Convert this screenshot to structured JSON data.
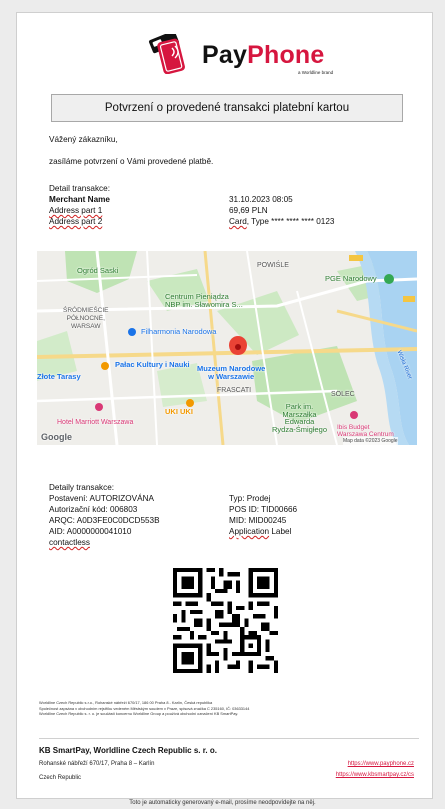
{
  "logo": {
    "brand_pay": "Pay",
    "brand_phone": "Phone",
    "sub": "a Worldline brand"
  },
  "title": "Potvrzení o provedené transakci platební kartou",
  "greeting": "Vážený zákazníku,",
  "intro": "zasíláme potvrzení o Vámi provedené platbě.",
  "detail_header": "Detail transakce:",
  "merchant": {
    "name": "Merchant Name",
    "address1": "Address part 1",
    "address2": "Address part 2",
    "datetime": "31.10.2023 08:05",
    "amount": "69,69 PLN",
    "card_prefix": "Card",
    "card_rest": ", Type **** **** **** 0123"
  },
  "map": {
    "labels": {
      "ogrod": "Ogród Saski",
      "powisle": "POWIŚLE",
      "srodmiescie": "ŚRÓDMIEŚCIE\nPÓŁNOCNE,\nWARSAW",
      "centrum": "Centrum Pieniądza\nNBP im. Sławomira S...",
      "pge": "PGE Narodowy",
      "filharmonia": "Filharmonia Narodowa",
      "zlote": "Złote Tarasy",
      "palac": "Pałac Kultury i Nauki",
      "muzeum": "Muzeum Narodowe\nw Warszawie",
      "frascati": "FRASCATI",
      "solec": "SOLEC",
      "park": "Park im.\nMarszałka\nEdwarda\nRydza-Śmigłego",
      "uki": "UKI UKI",
      "marriott": "Hotel Marriott Warszawa",
      "ibis": "Ibis Budget\nWarszawa Centrum",
      "wisla": "Wisła River",
      "google": "Google",
      "mapdata": "Map data ©2023 Google"
    }
  },
  "details": {
    "header": "Detaily transakce:",
    "status": "Postavení: AUTORIZOVÁNA",
    "auth_code": "Autorizační kód: 006803",
    "arqc": "ARQC: A0D3FE0C0DCD553B",
    "aid": "AID: A0000000041010",
    "contactless": "contactless",
    "type": "Typ: Prodej",
    "pos_id": "POS ID: TID00666",
    "mid": "MID: MID00245",
    "app_label_prefix": "Application",
    "app_label_rest": " Label"
  },
  "footer": {
    "legal1": "Worldline Czech Republic s.r.o., Rohanské nábřeží 670/17, 186 00 Praha 8 - Karlín, Česká republika",
    "legal2": "Společnost zapsána v obchodním rejstříku vedeném Městským soudem v Praze, spisová značka C 235160, IČ: 03633144",
    "legal3": "Worldline Czech Republic s. r. o. je součástí koncernu Worldline Group a používá obchodní označení KB SmartPay.",
    "company": "KB SmartPay, Worldline Czech Republic s. r. o.",
    "address1": "Rohanské nábřeží 670/17, Praha 8 – Karlín",
    "address2": "Czech Republic",
    "link1": "https://www.payphone.cz",
    "link2": "https://www.kbsmartpay.cz/cs",
    "auto_note": "Toto je automaticky generovaný e-mail, prosíme neodpovídejte na něj."
  },
  "colors": {
    "brand_red": "#d6163f",
    "park_green": "#bfe3b4",
    "water": "#a9d3f2"
  }
}
